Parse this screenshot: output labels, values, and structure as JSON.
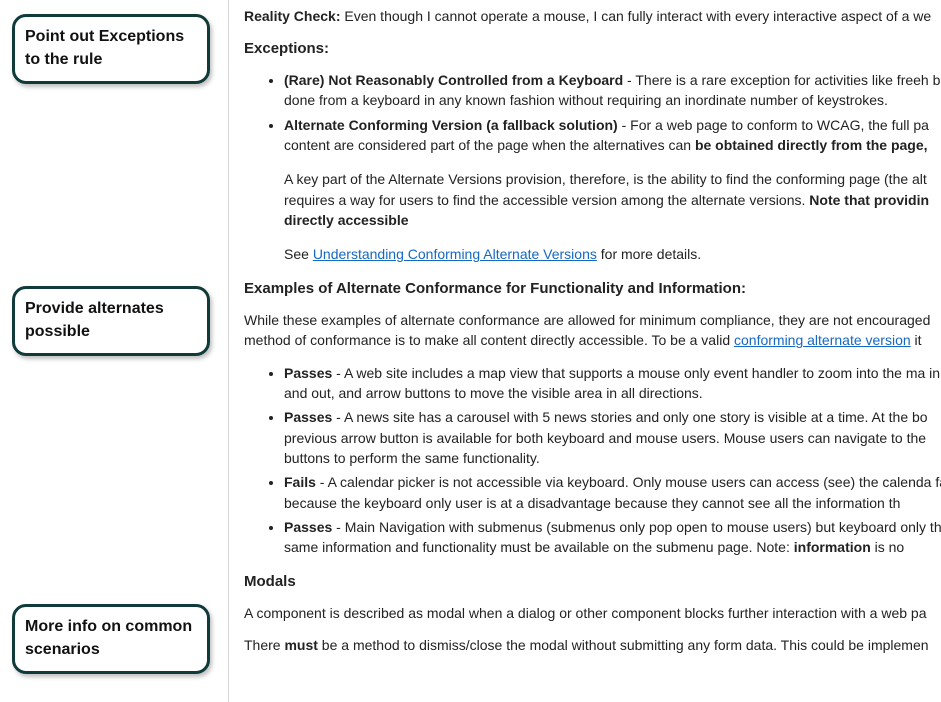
{
  "callouts": {
    "c1": "Point out Exceptions to the rule",
    "c2": "Provide alternates possible",
    "c3": "More info on common scenarios"
  },
  "content": {
    "reality_label": "Reality Check:",
    "reality_text": " Even though I cannot operate a mouse, I can fully interact with every interactive aspect of a we",
    "exceptions_heading": "Exceptions:",
    "ex1_bold": "(Rare) Not Reasonably Controlled from a Keyboard",
    "ex1_rest": " - There is a rare exception for activities like freeh be done from a keyboard in any known fashion without requiring an inordinate number of keystrokes.",
    "ex2_bold": "Alternate Conforming Version (a fallback solution)",
    "ex2_mid": " - For a web page to conform to WCAG, the full pa content are considered part of the page when the alternatives can ",
    "ex2_bold2": "be obtained directly from the page,",
    "ex2_p2_a": "A key part of the Alternate Versions provision, therefore, is the ability to find the conforming page (the alt requires a way for users to find the accessible version among the alternate versions. ",
    "ex2_p2_bold": "Note that providin directly accessible",
    "ex2_see_pre": "See ",
    "ex2_see_link": "Understanding Conforming Alternate Versions",
    "ex2_see_post": " for more details.",
    "examples_heading": "Examples of Alternate Conformance for Functionality and Information:",
    "examples_intro_a": "While these examples of alternate conformance are allowed for minimum compliance, they are not encouraged method of conformance is to make all content directly accessible. To be a valid ",
    "examples_intro_link": "conforming alternate version",
    "examples_intro_b": " it",
    "pass_label": "Passes",
    "fail_label": "Fails",
    "li1": " - A web site includes a map view that supports a mouse only event handler to zoom into the ma in and out, and arrow buttons to move the visible area in all directions.",
    "li2": " - A news site has a carousel with 5 news stories and only one story is visible at a time. At the bo previous arrow button is available for both keyboard and mouse users. Mouse users can navigate to the buttons to perform the same functionality.",
    "li3": " - A calendar picker is not accessible via keyboard. Only mouse users can access (see) the calenda fails because the keyboard only user is at a disadvantage because they cannot see all the information th",
    "li4_a": " - Main Navigation with submenus (submenus only pop open to mouse users) but keyboard only the same information and functionality must be available on the submenu page. Note: ",
    "li4_bold": "information",
    "li4_b": " is no",
    "modals_heading": "Modals",
    "modals_p1": "A component is described as modal when a dialog or other component blocks further interaction with a web pa",
    "modals_p2_a": "There ",
    "modals_p2_bold": "must",
    "modals_p2_b": " be a method to dismiss/close the modal without submitting any form data. This could be implemen"
  }
}
